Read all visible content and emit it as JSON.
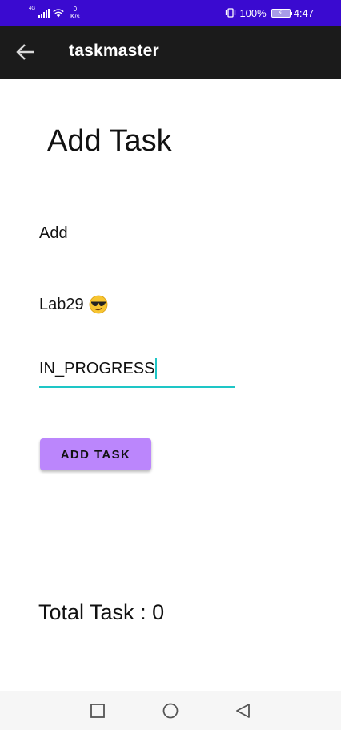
{
  "status_bar": {
    "network_type": "4G",
    "speed_value": "0",
    "speed_unit": "K/s",
    "battery": "100%",
    "time": "4:47",
    "background": "#3a0ad0"
  },
  "app_bar": {
    "title": "taskmaster",
    "back_icon": "arrow-back-icon",
    "background": "#1b1b1b"
  },
  "page": {
    "heading": "Add Task"
  },
  "form": {
    "task_title": "Add",
    "task_body": "Lab29",
    "task_body_emoji": "sunglasses-emoji",
    "task_state": "IN_PROGRESS",
    "accent": "#1ec6c6",
    "submit_label": "ADD TASK",
    "submit_color": "#bb86fc"
  },
  "summary": {
    "total_label": "Total Task : 0"
  },
  "nav_bar": {
    "recents_icon": "square-icon",
    "home_icon": "circle-icon",
    "back_icon": "triangle-back-icon"
  }
}
